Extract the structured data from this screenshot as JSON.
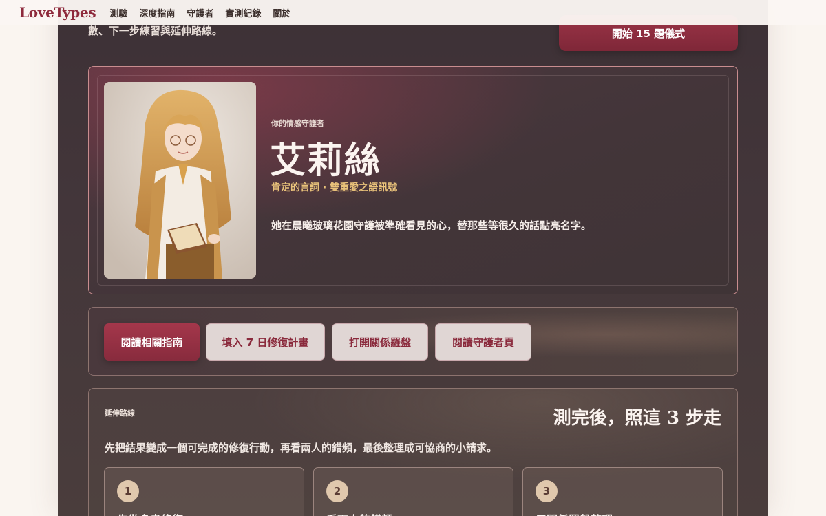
{
  "nav": {
    "brand": "LoveTypes",
    "links": [
      "測驗",
      "深度指南",
      "守護者",
      "實測紀錄",
      "關於"
    ]
  },
  "intro": {
    "text": "數、下一步練習與延伸路線。",
    "start_label": "開始 15 題儀式"
  },
  "guardian": {
    "kicker": "你的情感守護者",
    "name": "艾莉絲",
    "tagline": "肯定的言詞 · 雙重愛之語訊號",
    "description": "她在晨曦玻璃花園守護被準確看見的心，替那些等很久的話點亮名字。"
  },
  "actions": [
    {
      "label": "閱讀相關指南",
      "primary": true
    },
    {
      "label": "填入 7 日修復計畫",
      "primary": false
    },
    {
      "label": "打開關係羅盤",
      "primary": false
    },
    {
      "label": "閱讀守護者頁",
      "primary": false
    }
  ],
  "path": {
    "kicker": "延伸路線",
    "title": "測完後，照這 3 步走",
    "description": "先把結果變成一個可完成的修復行動，再看兩人的錯頻，最後整理成可協商的小請求。",
    "steps": [
      {
        "num": "1",
        "title": "先做多書修復"
      },
      {
        "num": "2",
        "title": "看兩人的錯頻"
      },
      {
        "num": "3",
        "title": "用關係羅盤整理"
      }
    ]
  },
  "colors": {
    "brand": "#8e2a3c",
    "accent_gold": "#e9c27a",
    "panel_dark": "#3d3136"
  }
}
